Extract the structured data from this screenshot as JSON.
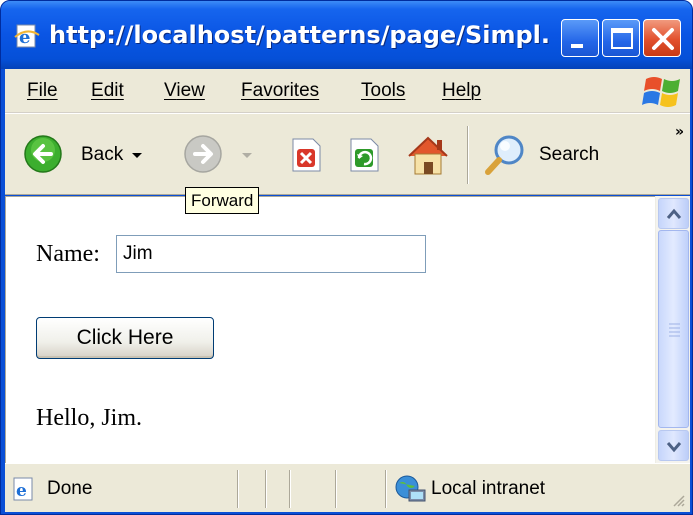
{
  "window": {
    "title": "http://localhost/patterns/page/Simpl..."
  },
  "menu": {
    "items": [
      {
        "key": "F",
        "rest": "ile"
      },
      {
        "key": "E",
        "rest": "dit"
      },
      {
        "key": "V",
        "rest": "iew"
      },
      {
        "key": "Fa",
        "rest": "vorites"
      },
      {
        "key": "T",
        "rest": "ools"
      },
      {
        "key": "H",
        "rest": "elp"
      }
    ]
  },
  "toolbar": {
    "back_label": "Back",
    "search_label": "Search",
    "overflow": "»"
  },
  "tooltip": {
    "text": "Forward"
  },
  "page": {
    "name_label": "Name:",
    "name_value": "Jim",
    "button_label": "Click Here",
    "greeting": "Hello, Jim."
  },
  "status": {
    "state": "Done",
    "zone": "Local intranet"
  },
  "icons": {
    "back": "back-arrow-icon",
    "forward": "forward-arrow-icon",
    "stop": "stop-icon",
    "refresh": "refresh-icon",
    "home": "home-icon",
    "search": "search-icon"
  },
  "colors": {
    "titlebar": "#0a55e4",
    "chrome": "#ece9d8",
    "back_green": "#3cae2e",
    "stop_red": "#d9372a"
  }
}
